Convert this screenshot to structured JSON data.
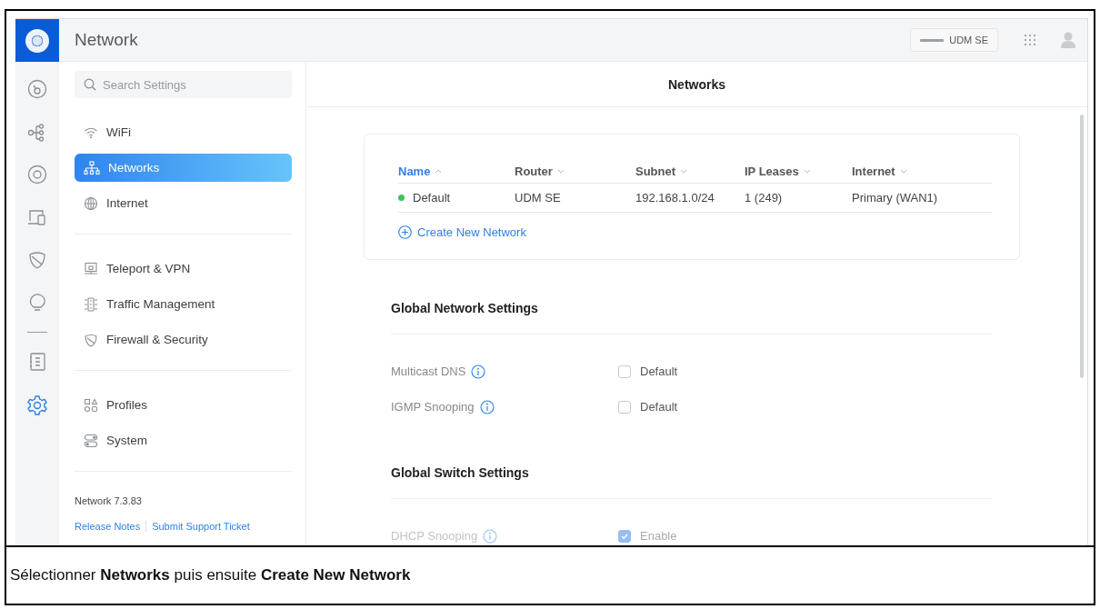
{
  "app_header": {
    "title": "Network",
    "device": "UDM SE"
  },
  "rail": [
    {
      "kind": "dashboard",
      "selected": false
    },
    {
      "kind": "topology",
      "selected": false
    },
    {
      "kind": "devices",
      "selected": false
    },
    {
      "kind": "clients",
      "selected": false
    },
    {
      "kind": "security",
      "selected": false
    },
    {
      "kind": "insights",
      "selected": false
    },
    {
      "kind": "logs",
      "selected": false
    },
    {
      "kind": "settings",
      "selected": true
    }
  ],
  "sidebar": {
    "search_placeholder": "Search Settings",
    "groups": [
      [
        {
          "label": "WiFi",
          "selected": false
        },
        {
          "label": "Networks",
          "selected": true
        },
        {
          "label": "Internet",
          "selected": false
        }
      ],
      [
        {
          "label": "Teleport & VPN",
          "selected": false
        },
        {
          "label": "Traffic Management",
          "selected": false
        },
        {
          "label": "Firewall & Security",
          "selected": false
        }
      ],
      [
        {
          "label": "Profiles",
          "selected": false
        },
        {
          "label": "System",
          "selected": false
        }
      ]
    ],
    "version": "Network 7.3.83",
    "links": [
      "Release Notes",
      "Submit Support Ticket"
    ]
  },
  "page_title": "Networks",
  "networks_table": {
    "columns": [
      {
        "label": "Name",
        "selected": true
      },
      {
        "label": "Router",
        "selected": false
      },
      {
        "label": "Subnet",
        "selected": false
      },
      {
        "label": "IP Leases",
        "selected": false
      },
      {
        "label": "Internet",
        "selected": false
      }
    ],
    "rows": [
      {
        "color": "#3cc35a",
        "cells": [
          "Default",
          "UDM SE",
          "192.168.1.0/24",
          "1 (249)",
          "Primary (WAN1)"
        ]
      }
    ],
    "create_link": "Create New Network"
  },
  "sections": [
    {
      "title": "Global Network Settings",
      "settings": [
        {
          "label": "Multicast DNS",
          "option": "Default",
          "checked": false,
          "disabled": false
        },
        {
          "label": "IGMP Snooping",
          "option": "Default",
          "checked": false,
          "disabled": false
        }
      ]
    },
    {
      "title": "Global Switch Settings",
      "settings": [
        {
          "label": "DHCP Snooping",
          "option": "Enable",
          "checked": true,
          "disabled": true
        }
      ]
    }
  ],
  "caption": "Sélectionner **Networks** puis ensuite **Create New Network**"
}
